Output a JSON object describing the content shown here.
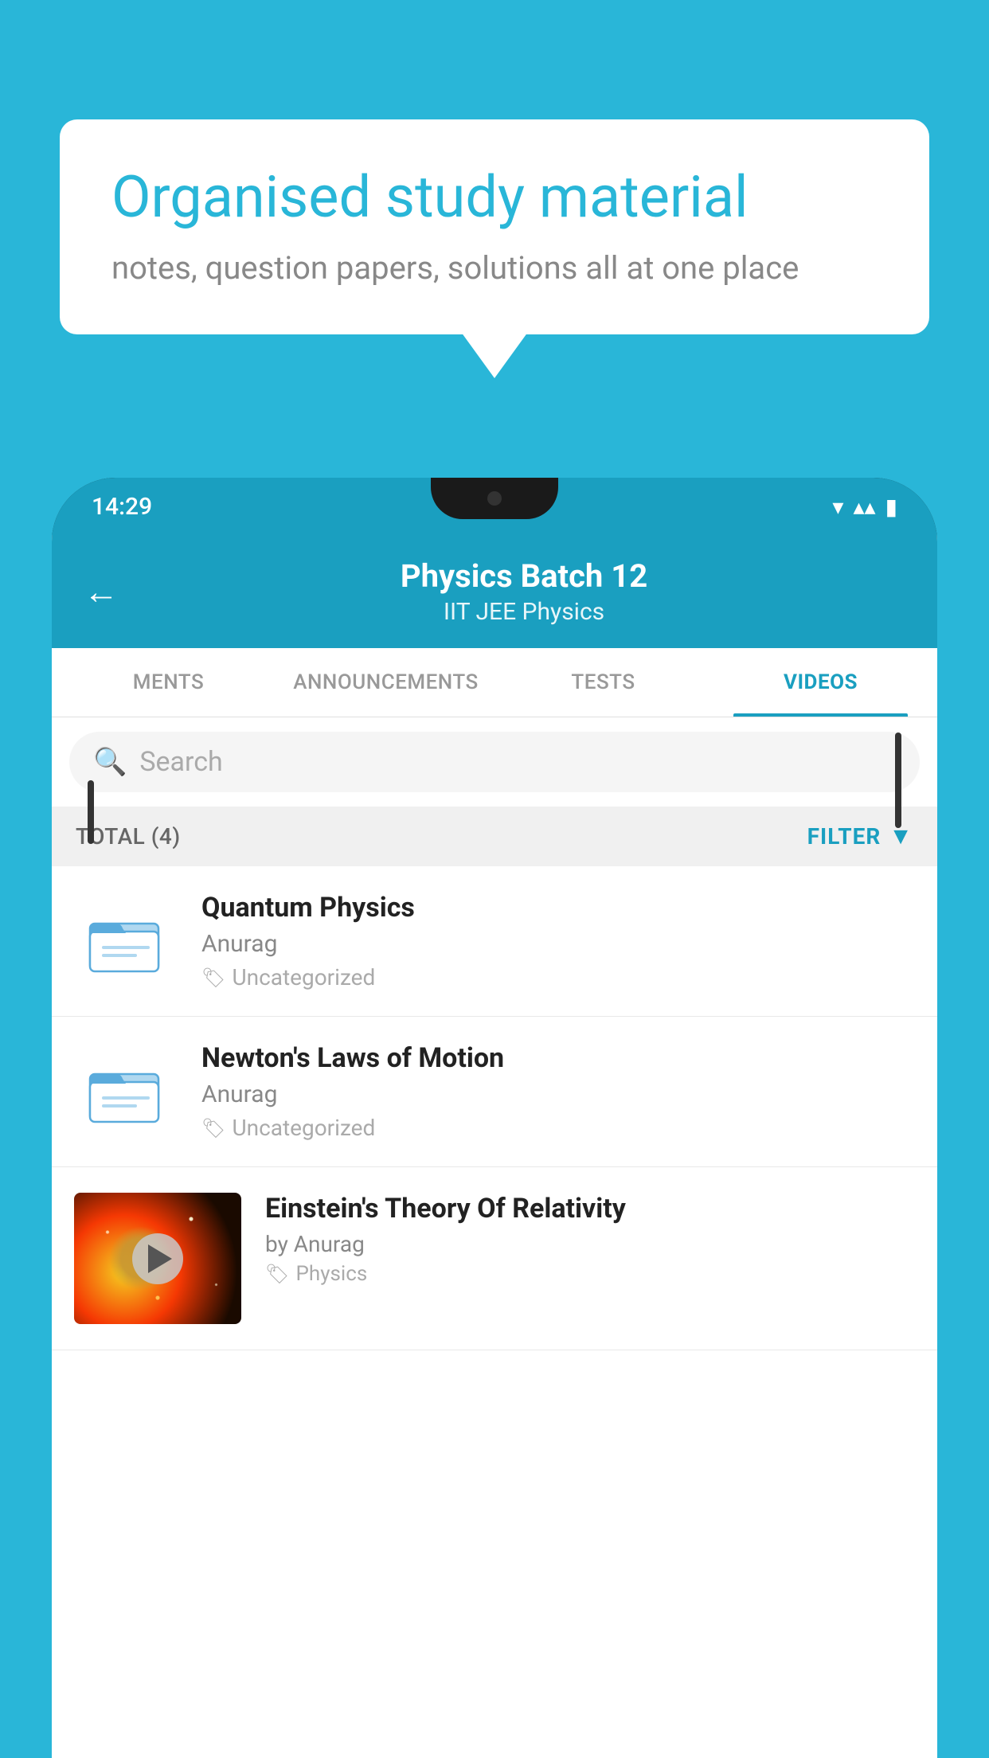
{
  "background_color": "#29b6d8",
  "speech_bubble": {
    "title": "Organised study material",
    "subtitle": "notes, question papers, solutions all at one place"
  },
  "status_bar": {
    "time": "14:29",
    "wifi_icon": "▾",
    "signal_icon": "▴▴",
    "battery_icon": "▮"
  },
  "header": {
    "back_label": "←",
    "title": "Physics Batch 12",
    "subtitle": "IIT JEE   Physics"
  },
  "tabs": [
    {
      "label": "MENTS",
      "active": false
    },
    {
      "label": "ANNOUNCEMENTS",
      "active": false
    },
    {
      "label": "TESTS",
      "active": false
    },
    {
      "label": "VIDEOS",
      "active": true
    }
  ],
  "search": {
    "placeholder": "Search"
  },
  "filter_bar": {
    "total_label": "TOTAL (4)",
    "filter_label": "FILTER"
  },
  "videos": [
    {
      "id": 1,
      "title": "Quantum Physics",
      "author": "Anurag",
      "tag": "Uncategorized",
      "type": "folder"
    },
    {
      "id": 2,
      "title": "Newton's Laws of Motion",
      "author": "Anurag",
      "tag": "Uncategorized",
      "type": "folder"
    },
    {
      "id": 3,
      "title": "Einstein's Theory Of Relativity",
      "author": "by Anurag",
      "tag": "Physics",
      "type": "video"
    }
  ]
}
